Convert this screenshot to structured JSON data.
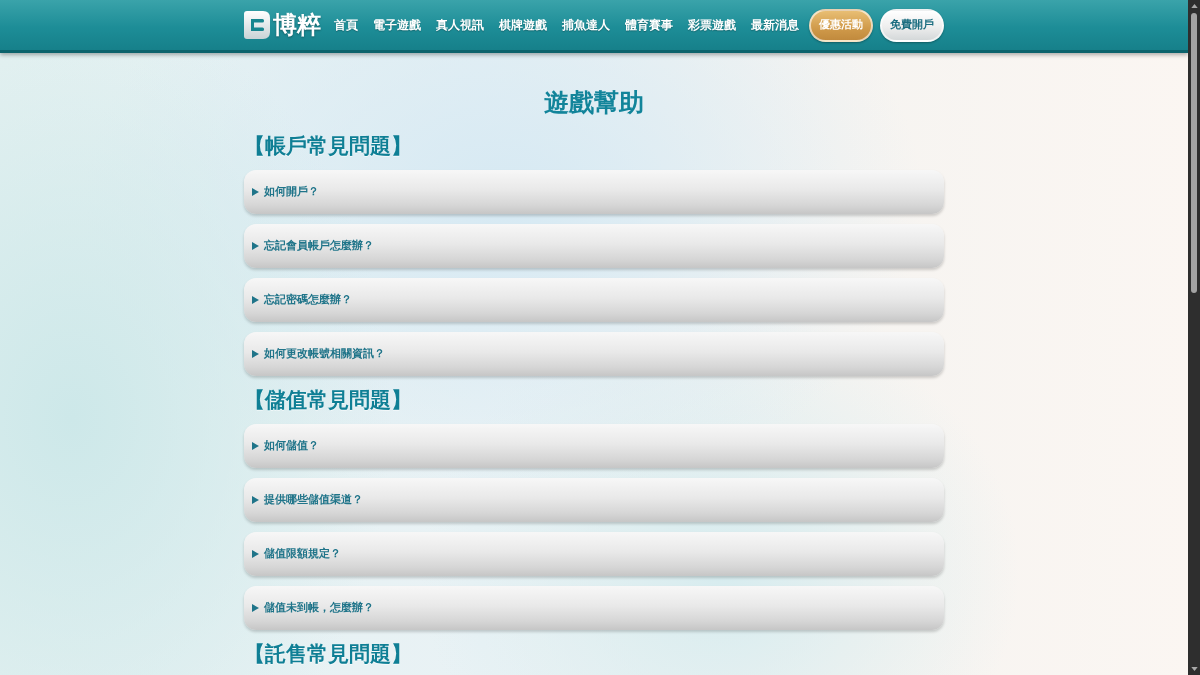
{
  "header": {
    "logo": {
      "text": "博粹"
    },
    "nav": [
      {
        "label": "首頁"
      },
      {
        "label": "電子遊戲"
      },
      {
        "label": "真人視訊"
      },
      {
        "label": "棋牌遊戲"
      },
      {
        "label": "捕魚達人"
      },
      {
        "label": "體育賽事"
      },
      {
        "label": "彩票遊戲"
      },
      {
        "label": "最新消息"
      }
    ],
    "buttons": [
      {
        "label": "優惠活動",
        "kind": "promo"
      },
      {
        "label": "免費開戶",
        "kind": "signup"
      }
    ]
  },
  "page": {
    "title": "遊戲幫助",
    "sections": [
      {
        "heading": "【帳戶常見問題】",
        "questions": [
          {
            "text": "如何開戶？",
            "expanded": false
          },
          {
            "text": "忘記會員帳戶怎麼辦？",
            "expanded": false
          },
          {
            "text": "忘記密碼怎麼辦？",
            "expanded": false
          },
          {
            "text": "如何更改帳號相關資訊？",
            "expanded": false
          }
        ]
      },
      {
        "heading": "【儲值常見問題】",
        "questions": [
          {
            "text": "如何儲值？",
            "expanded": false
          },
          {
            "text": "提供哪些儲值渠道？",
            "expanded": false
          },
          {
            "text": "儲值限額規定？",
            "expanded": false
          },
          {
            "text": "儲值未到帳，怎麼辦？",
            "expanded": false
          }
        ]
      },
      {
        "heading": "【託售常見問題】"
      }
    ]
  }
}
